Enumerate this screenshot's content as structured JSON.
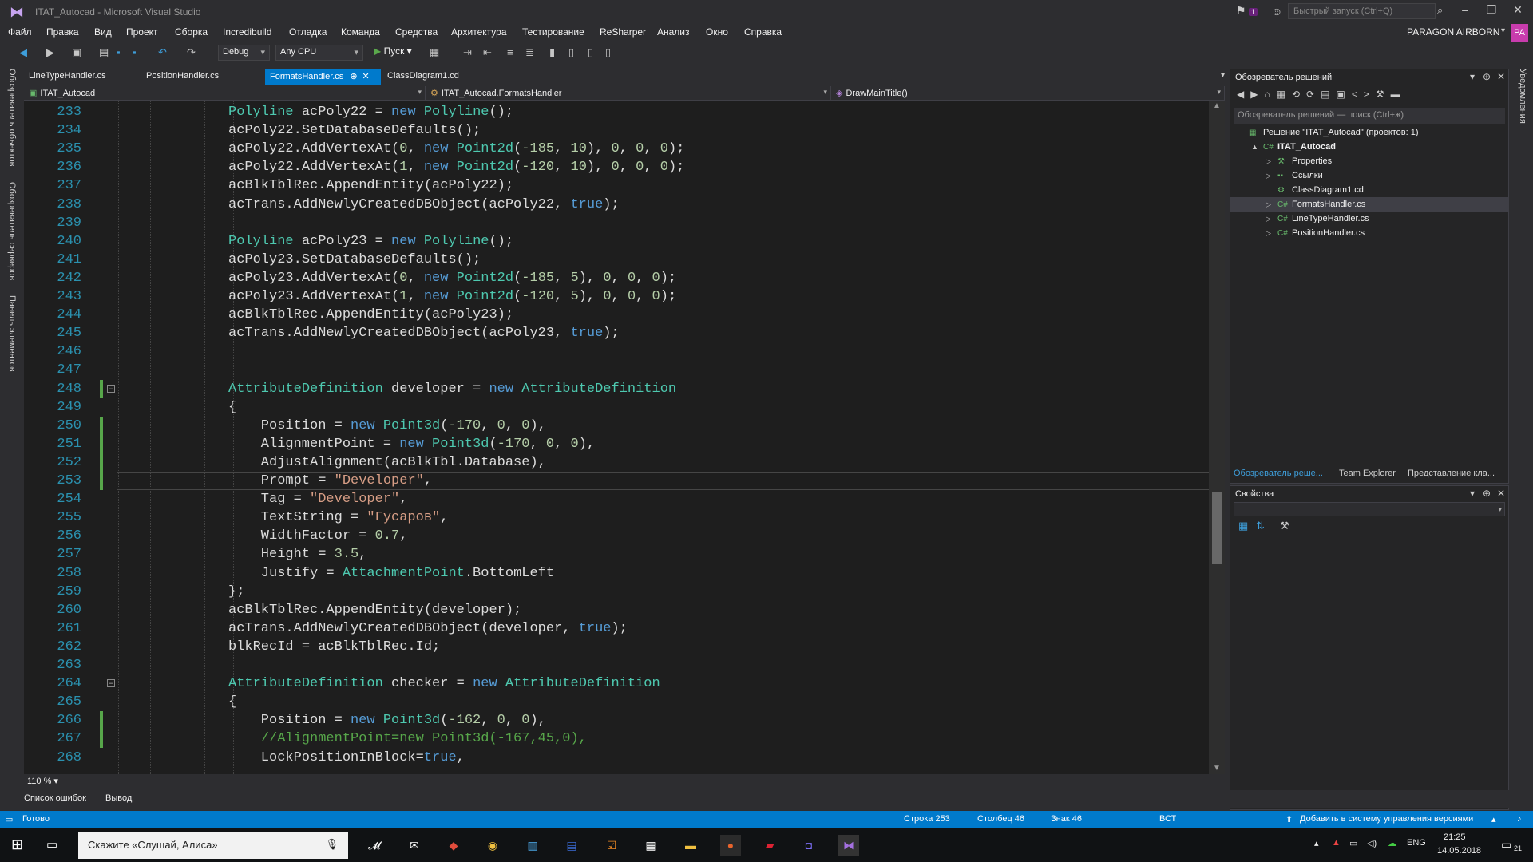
{
  "window": {
    "title": "ITAT_Autocad - Microsoft Visual Studio",
    "notification_count": "1",
    "quick_launch_placeholder": "Быстрый запуск (Ctrl+Q)",
    "account_name": "PARAGON AIRBORN",
    "avatar_initials": "PA"
  },
  "menu": [
    "Файл",
    "Правка",
    "Вид",
    "Проект",
    "Сборка",
    "Incredibuild",
    "Отладка",
    "Команда",
    "Средства",
    "Архитектура",
    "Тестирование",
    "ReSharper",
    "Анализ",
    "Окно",
    "Справка"
  ],
  "toolbar": {
    "config": "Debug",
    "platform": "Any CPU",
    "run_label": "Пуск"
  },
  "left_vertical_tabs": [
    "Обозреватель объектов",
    "Обозреватель серверов",
    "Панель элементов"
  ],
  "right_vertical_tabs": [
    "Уведомления"
  ],
  "doc_tabs": [
    {
      "label": "LineTypeHandler.cs",
      "active": false
    },
    {
      "label": "PositionHandler.cs",
      "active": false
    },
    {
      "label": "FormatsHandler.cs",
      "active": true
    },
    {
      "label": "ClassDiagram1.cd",
      "active": false
    }
  ],
  "navbar": {
    "project": "ITAT_Autocad",
    "class": "ITAT_Autocad.FormatsHandler",
    "member": "DrawMainTitle()"
  },
  "editor": {
    "zoom": "110 %",
    "current_line": 253,
    "lines": [
      {
        "n": 233,
        "indent": 14,
        "tokens": [
          [
            "t",
            "Polyline"
          ],
          [
            "p",
            " acPoly22 = "
          ],
          [
            "k",
            "new"
          ],
          [
            "p",
            " "
          ],
          [
            "t",
            "Polyline"
          ],
          [
            "p",
            "();"
          ]
        ]
      },
      {
        "n": 234,
        "indent": 14,
        "tokens": [
          [
            "p",
            "acPoly22.SetDatabaseDefaults();"
          ]
        ]
      },
      {
        "n": 235,
        "indent": 14,
        "tokens": [
          [
            "p",
            "acPoly22.AddVertexAt("
          ],
          [
            "n",
            "0"
          ],
          [
            "p",
            ", "
          ],
          [
            "k",
            "new"
          ],
          [
            "p",
            " "
          ],
          [
            "t",
            "Point2d"
          ],
          [
            "p",
            "("
          ],
          [
            "n",
            "-185"
          ],
          [
            "p",
            ", "
          ],
          [
            "n",
            "10"
          ],
          [
            "p",
            "), "
          ],
          [
            "n",
            "0"
          ],
          [
            "p",
            ", "
          ],
          [
            "n",
            "0"
          ],
          [
            "p",
            ", "
          ],
          [
            "n",
            "0"
          ],
          [
            "p",
            ");"
          ]
        ]
      },
      {
        "n": 236,
        "indent": 14,
        "tokens": [
          [
            "p",
            "acPoly22.AddVertexAt("
          ],
          [
            "n",
            "1"
          ],
          [
            "p",
            ", "
          ],
          [
            "k",
            "new"
          ],
          [
            "p",
            " "
          ],
          [
            "t",
            "Point2d"
          ],
          [
            "p",
            "("
          ],
          [
            "n",
            "-120"
          ],
          [
            "p",
            ", "
          ],
          [
            "n",
            "10"
          ],
          [
            "p",
            "), "
          ],
          [
            "n",
            "0"
          ],
          [
            "p",
            ", "
          ],
          [
            "n",
            "0"
          ],
          [
            "p",
            ", "
          ],
          [
            "n",
            "0"
          ],
          [
            "p",
            ");"
          ]
        ]
      },
      {
        "n": 237,
        "indent": 14,
        "tokens": [
          [
            "p",
            "acBlkTblRec.AppendEntity(acPoly22);"
          ]
        ]
      },
      {
        "n": 238,
        "indent": 14,
        "tokens": [
          [
            "p",
            "acTrans.AddNewlyCreatedDBObject(acPoly22, "
          ],
          [
            "k",
            "true"
          ],
          [
            "p",
            ");"
          ]
        ]
      },
      {
        "n": 239,
        "indent": 14,
        "tokens": []
      },
      {
        "n": 240,
        "indent": 14,
        "tokens": [
          [
            "t",
            "Polyline"
          ],
          [
            "p",
            " acPoly23 = "
          ],
          [
            "k",
            "new"
          ],
          [
            "p",
            " "
          ],
          [
            "t",
            "Polyline"
          ],
          [
            "p",
            "();"
          ]
        ]
      },
      {
        "n": 241,
        "indent": 14,
        "tokens": [
          [
            "p",
            "acPoly23.SetDatabaseDefaults();"
          ]
        ]
      },
      {
        "n": 242,
        "indent": 14,
        "tokens": [
          [
            "p",
            "acPoly23.AddVertexAt("
          ],
          [
            "n",
            "0"
          ],
          [
            "p",
            ", "
          ],
          [
            "k",
            "new"
          ],
          [
            "p",
            " "
          ],
          [
            "t",
            "Point2d"
          ],
          [
            "p",
            "("
          ],
          [
            "n",
            "-185"
          ],
          [
            "p",
            ", "
          ],
          [
            "n",
            "5"
          ],
          [
            "p",
            "), "
          ],
          [
            "n",
            "0"
          ],
          [
            "p",
            ", "
          ],
          [
            "n",
            "0"
          ],
          [
            "p",
            ", "
          ],
          [
            "n",
            "0"
          ],
          [
            "p",
            ");"
          ]
        ]
      },
      {
        "n": 243,
        "indent": 14,
        "tokens": [
          [
            "p",
            "acPoly23.AddVertexAt("
          ],
          [
            "n",
            "1"
          ],
          [
            "p",
            ", "
          ],
          [
            "k",
            "new"
          ],
          [
            "p",
            " "
          ],
          [
            "t",
            "Point2d"
          ],
          [
            "p",
            "("
          ],
          [
            "n",
            "-120"
          ],
          [
            "p",
            ", "
          ],
          [
            "n",
            "5"
          ],
          [
            "p",
            "), "
          ],
          [
            "n",
            "0"
          ],
          [
            "p",
            ", "
          ],
          [
            "n",
            "0"
          ],
          [
            "p",
            ", "
          ],
          [
            "n",
            "0"
          ],
          [
            "p",
            ");"
          ]
        ]
      },
      {
        "n": 244,
        "indent": 14,
        "tokens": [
          [
            "p",
            "acBlkTblRec.AppendEntity(acPoly23);"
          ]
        ]
      },
      {
        "n": 245,
        "indent": 14,
        "tokens": [
          [
            "p",
            "acTrans.AddNewlyCreatedDBObject(acPoly23, "
          ],
          [
            "k",
            "true"
          ],
          [
            "p",
            ");"
          ]
        ]
      },
      {
        "n": 246,
        "indent": 14,
        "tokens": []
      },
      {
        "n": 247,
        "indent": 14,
        "tokens": []
      },
      {
        "n": 248,
        "indent": 14,
        "tokens": [
          [
            "t",
            "AttributeDefinition"
          ],
          [
            "p",
            " developer = "
          ],
          [
            "k",
            "new"
          ],
          [
            "p",
            " "
          ],
          [
            "t",
            "AttributeDefinition"
          ]
        ]
      },
      {
        "n": 249,
        "indent": 14,
        "tokens": [
          [
            "p",
            "{"
          ]
        ]
      },
      {
        "n": 250,
        "indent": 18,
        "tokens": [
          [
            "p",
            "Position = "
          ],
          [
            "k",
            "new"
          ],
          [
            "p",
            " "
          ],
          [
            "t",
            "Point3d"
          ],
          [
            "p",
            "("
          ],
          [
            "n",
            "-170"
          ],
          [
            "p",
            ", "
          ],
          [
            "n",
            "0"
          ],
          [
            "p",
            ", "
          ],
          [
            "n",
            "0"
          ],
          [
            "p",
            "),"
          ]
        ]
      },
      {
        "n": 251,
        "indent": 18,
        "tokens": [
          [
            "p",
            "AlignmentPoint = "
          ],
          [
            "k",
            "new"
          ],
          [
            "p",
            " "
          ],
          [
            "t",
            "Point3d"
          ],
          [
            "p",
            "("
          ],
          [
            "n",
            "-170"
          ],
          [
            "p",
            ", "
          ],
          [
            "n",
            "0"
          ],
          [
            "p",
            ", "
          ],
          [
            "n",
            "0"
          ],
          [
            "p",
            "),"
          ]
        ]
      },
      {
        "n": 252,
        "indent": 18,
        "tokens": [
          [
            "p",
            "AdjustAlignment(acBlkTbl.Database),"
          ]
        ]
      },
      {
        "n": 253,
        "indent": 18,
        "tokens": [
          [
            "p",
            "Prompt = "
          ],
          [
            "s",
            "\"Developer\""
          ],
          [
            "p",
            ","
          ]
        ]
      },
      {
        "n": 254,
        "indent": 18,
        "tokens": [
          [
            "p",
            "Tag = "
          ],
          [
            "s",
            "\"Developer\""
          ],
          [
            "p",
            ","
          ]
        ]
      },
      {
        "n": 255,
        "indent": 18,
        "tokens": [
          [
            "p",
            "TextString = "
          ],
          [
            "s",
            "\"Гусаров\""
          ],
          [
            "p",
            ","
          ]
        ]
      },
      {
        "n": 256,
        "indent": 18,
        "tokens": [
          [
            "p",
            "WidthFactor = "
          ],
          [
            "n",
            "0.7"
          ],
          [
            "p",
            ","
          ]
        ]
      },
      {
        "n": 257,
        "indent": 18,
        "tokens": [
          [
            "p",
            "Height = "
          ],
          [
            "n",
            "3.5"
          ],
          [
            "p",
            ","
          ]
        ]
      },
      {
        "n": 258,
        "indent": 18,
        "tokens": [
          [
            "p",
            "Justify = "
          ],
          [
            "t",
            "AttachmentPoint"
          ],
          [
            "p",
            ".BottomLeft"
          ]
        ]
      },
      {
        "n": 259,
        "indent": 14,
        "tokens": [
          [
            "p",
            "};"
          ]
        ]
      },
      {
        "n": 260,
        "indent": 14,
        "tokens": [
          [
            "p",
            "acBlkTblRec.AppendEntity(developer);"
          ]
        ]
      },
      {
        "n": 261,
        "indent": 14,
        "tokens": [
          [
            "p",
            "acTrans.AddNewlyCreatedDBObject(developer, "
          ],
          [
            "k",
            "true"
          ],
          [
            "p",
            ");"
          ]
        ]
      },
      {
        "n": 262,
        "indent": 14,
        "tokens": [
          [
            "p",
            "blkRecId = acBlkTblRec.Id;"
          ]
        ]
      },
      {
        "n": 263,
        "indent": 14,
        "tokens": []
      },
      {
        "n": 264,
        "indent": 14,
        "tokens": [
          [
            "t",
            "AttributeDefinition"
          ],
          [
            "p",
            " checker = "
          ],
          [
            "k",
            "new"
          ],
          [
            "p",
            " "
          ],
          [
            "t",
            "AttributeDefinition"
          ]
        ]
      },
      {
        "n": 265,
        "indent": 14,
        "tokens": [
          [
            "p",
            "{"
          ]
        ]
      },
      {
        "n": 266,
        "indent": 18,
        "tokens": [
          [
            "p",
            "Position = "
          ],
          [
            "k",
            "new"
          ],
          [
            "p",
            " "
          ],
          [
            "t",
            "Point3d"
          ],
          [
            "p",
            "("
          ],
          [
            "n",
            "-162"
          ],
          [
            "p",
            ", "
          ],
          [
            "n",
            "0"
          ],
          [
            "p",
            ", "
          ],
          [
            "n",
            "0"
          ],
          [
            "p",
            "),"
          ]
        ]
      },
      {
        "n": 267,
        "indent": 18,
        "tokens": [
          [
            "c",
            "//AlignmentPoint=new Point3d(-167,45,0),"
          ]
        ]
      },
      {
        "n": 268,
        "indent": 18,
        "tokens": [
          [
            "p",
            "LockPositionInBlock="
          ],
          [
            "k",
            "true"
          ],
          [
            "p",
            ","
          ]
        ]
      }
    ]
  },
  "solution_explorer": {
    "title": "Обозреватель решений",
    "search_placeholder": "Обозреватель решений — поиск (Ctrl+ж)",
    "items": [
      {
        "label": "Решение \"ITAT_Autocad\" (проектов: 1)",
        "depth": 0,
        "icon": "solution-icon",
        "arrow": "",
        "selected": false
      },
      {
        "label": "ITAT_Autocad",
        "depth": 1,
        "icon": "csharp-project-icon",
        "arrow": "▲",
        "selected": false
      },
      {
        "label": "Properties",
        "depth": 2,
        "icon": "wrench-icon",
        "arrow": "▷",
        "selected": false
      },
      {
        "label": "Ссылки",
        "depth": 2,
        "icon": "references-icon",
        "arrow": "▷",
        "selected": false
      },
      {
        "label": "ClassDiagram1.cd",
        "depth": 2,
        "icon": "class-diagram-icon",
        "arrow": "",
        "selected": false
      },
      {
        "label": "FormatsHandler.cs",
        "depth": 2,
        "icon": "csharp-file-icon",
        "arrow": "▷",
        "selected": true
      },
      {
        "label": "LineTypeHandler.cs",
        "depth": 2,
        "icon": "csharp-file-icon",
        "arrow": "▷",
        "selected": false
      },
      {
        "label": "PositionHandler.cs",
        "depth": 2,
        "icon": "csharp-file-icon",
        "arrow": "▷",
        "selected": false
      }
    ],
    "bottom_tabs": [
      "Обозреватель реше...",
      "Team Explorer",
      "Представление кла..."
    ]
  },
  "properties": {
    "title": "Свойства"
  },
  "output_tabs": [
    "Список ошибок",
    "Вывод"
  ],
  "statusbar": {
    "ready": "Готово",
    "line": "Строка 253",
    "column": "Столбец 46",
    "char": "Знак 46",
    "mode": "ВСТ",
    "vcs": "Добавить в систему управления версиями"
  },
  "taskbar": {
    "search_placeholder": "Скажите «Слушай, Алиса»",
    "lang": "ENG",
    "time": "21:25",
    "date": "14.05.2018",
    "notifications": "21"
  }
}
